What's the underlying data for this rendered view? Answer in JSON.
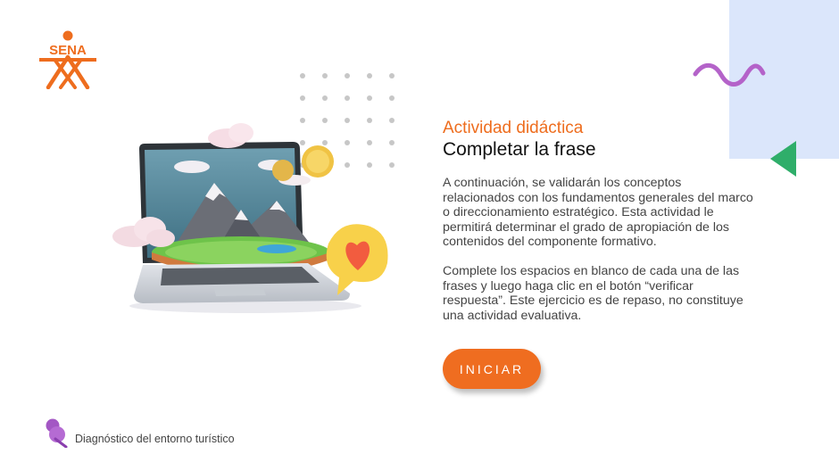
{
  "brand": {
    "logo_text": "SENA",
    "logo_color": "#ee6d1e"
  },
  "activity": {
    "subtitle": "Actividad didáctica",
    "title": "Completar la frase",
    "paragraph_1": "A continuación, se validarán los conceptos relacionados con los fundamentos generales del marco o direccionamiento estratégico. Esta actividad le permitirá determinar el grado de apropiación de los contenidos del componente formativo.",
    "paragraph_2": "Complete los espacios en blanco de cada una de las frases y luego haga clic en el botón “verificar respuesta”. Este ejercicio es de repaso, no constituye una actividad evaluativa."
  },
  "start_button": {
    "label": "INICIAR",
    "color": "#ef6d20"
  },
  "footer": {
    "label": "Diagnóstico del entorno turístico",
    "icon": "pin-icon",
    "icon_color": "#a357c4"
  },
  "decor": {
    "panel_color": "#dbe6fb",
    "wave_color": "#b463c9",
    "triangle_color": "#2fae6a"
  }
}
